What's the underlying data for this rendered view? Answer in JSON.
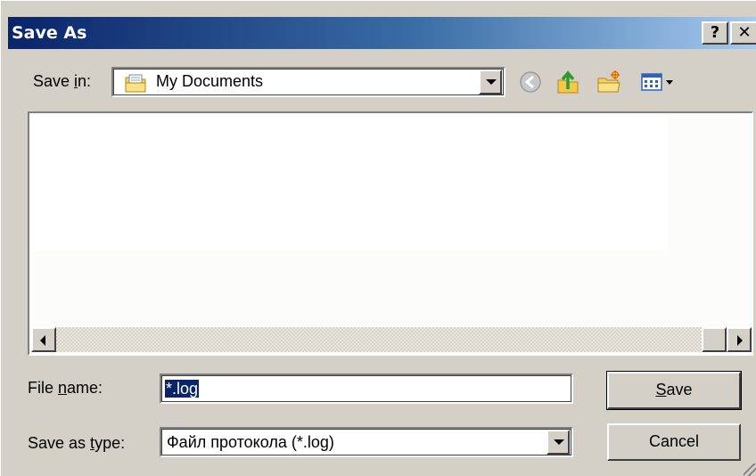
{
  "window": {
    "title": "Save As",
    "help_glyph": "?",
    "close_glyph": "✕"
  },
  "save_in": {
    "label_pre": "Save ",
    "label_u": "i",
    "label_post": "n:",
    "value": "My Documents"
  },
  "toolbar": {
    "icons": [
      "back-icon",
      "up-folder-icon",
      "new-folder-icon",
      "views-menu-icon"
    ]
  },
  "file_name": {
    "label_pre": "File ",
    "label_u": "n",
    "label_post": "ame:",
    "value": "*.log"
  },
  "save_as_type": {
    "label_pre": "Save as ",
    "label_u": "t",
    "label_post": "ype:",
    "value": "Файл протокола (*.log)"
  },
  "buttons": {
    "save_u": "S",
    "save_rest": "ave",
    "cancel": "Cancel"
  },
  "colors": {
    "title_start": "#0a246a",
    "title_end": "#a6caf0",
    "face": "#d4d0c8",
    "selection": "#0a246a"
  }
}
